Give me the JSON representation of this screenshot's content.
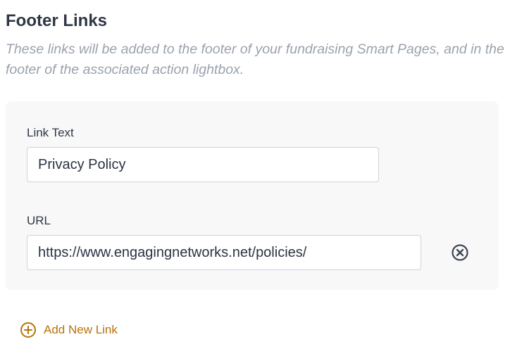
{
  "section": {
    "title": "Footer Links",
    "description": "These links will be added to the footer of your fundraising Smart Pages, and in the footer of the associated action lightbox."
  },
  "link": {
    "text_label": "Link Text",
    "text_value": "Privacy Policy",
    "url_label": "URL",
    "url_value": "https://www.engagingnetworks.net/policies/",
    "remove_icon": "circle-x-icon"
  },
  "add_link": {
    "label": "Add New Link",
    "icon": "circle-plus-icon"
  },
  "colors": {
    "accent": "#b8730a",
    "title": "#2f3744",
    "description": "#9aa2ad",
    "panel_bg": "#f8f8f9",
    "input_border": "#cfd3d9",
    "remove_icon": "#3d4554"
  }
}
